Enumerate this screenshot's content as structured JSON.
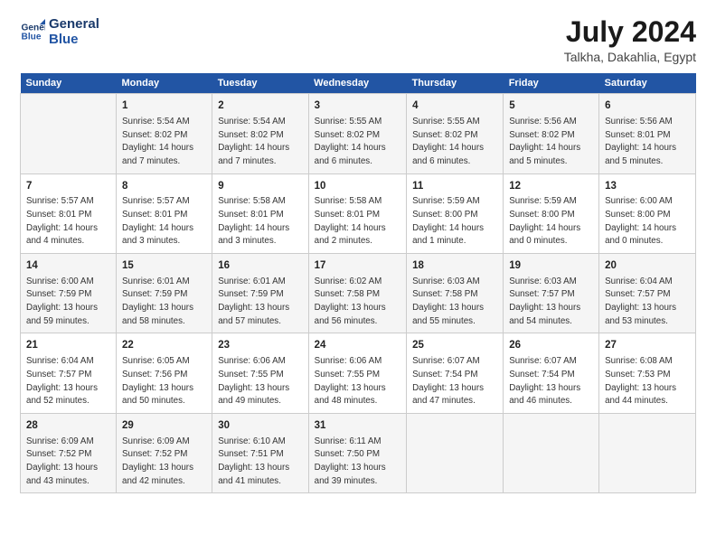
{
  "header": {
    "logo_line1": "General",
    "logo_line2": "Blue",
    "title": "July 2024",
    "subtitle": "Talkha, Dakahlia, Egypt"
  },
  "columns": [
    "Sunday",
    "Monday",
    "Tuesday",
    "Wednesday",
    "Thursday",
    "Friday",
    "Saturday"
  ],
  "weeks": [
    [
      {
        "day": "",
        "info": ""
      },
      {
        "day": "1",
        "info": "Sunrise: 5:54 AM\nSunset: 8:02 PM\nDaylight: 14 hours\nand 7 minutes."
      },
      {
        "day": "2",
        "info": "Sunrise: 5:54 AM\nSunset: 8:02 PM\nDaylight: 14 hours\nand 7 minutes."
      },
      {
        "day": "3",
        "info": "Sunrise: 5:55 AM\nSunset: 8:02 PM\nDaylight: 14 hours\nand 6 minutes."
      },
      {
        "day": "4",
        "info": "Sunrise: 5:55 AM\nSunset: 8:02 PM\nDaylight: 14 hours\nand 6 minutes."
      },
      {
        "day": "5",
        "info": "Sunrise: 5:56 AM\nSunset: 8:02 PM\nDaylight: 14 hours\nand 5 minutes."
      },
      {
        "day": "6",
        "info": "Sunrise: 5:56 AM\nSunset: 8:01 PM\nDaylight: 14 hours\nand 5 minutes."
      }
    ],
    [
      {
        "day": "7",
        "info": "Sunrise: 5:57 AM\nSunset: 8:01 PM\nDaylight: 14 hours\nand 4 minutes."
      },
      {
        "day": "8",
        "info": "Sunrise: 5:57 AM\nSunset: 8:01 PM\nDaylight: 14 hours\nand 3 minutes."
      },
      {
        "day": "9",
        "info": "Sunrise: 5:58 AM\nSunset: 8:01 PM\nDaylight: 14 hours\nand 3 minutes."
      },
      {
        "day": "10",
        "info": "Sunrise: 5:58 AM\nSunset: 8:01 PM\nDaylight: 14 hours\nand 2 minutes."
      },
      {
        "day": "11",
        "info": "Sunrise: 5:59 AM\nSunset: 8:00 PM\nDaylight: 14 hours\nand 1 minute."
      },
      {
        "day": "12",
        "info": "Sunrise: 5:59 AM\nSunset: 8:00 PM\nDaylight: 14 hours\nand 0 minutes."
      },
      {
        "day": "13",
        "info": "Sunrise: 6:00 AM\nSunset: 8:00 PM\nDaylight: 14 hours\nand 0 minutes."
      }
    ],
    [
      {
        "day": "14",
        "info": "Sunrise: 6:00 AM\nSunset: 7:59 PM\nDaylight: 13 hours\nand 59 minutes."
      },
      {
        "day": "15",
        "info": "Sunrise: 6:01 AM\nSunset: 7:59 PM\nDaylight: 13 hours\nand 58 minutes."
      },
      {
        "day": "16",
        "info": "Sunrise: 6:01 AM\nSunset: 7:59 PM\nDaylight: 13 hours\nand 57 minutes."
      },
      {
        "day": "17",
        "info": "Sunrise: 6:02 AM\nSunset: 7:58 PM\nDaylight: 13 hours\nand 56 minutes."
      },
      {
        "day": "18",
        "info": "Sunrise: 6:03 AM\nSunset: 7:58 PM\nDaylight: 13 hours\nand 55 minutes."
      },
      {
        "day": "19",
        "info": "Sunrise: 6:03 AM\nSunset: 7:57 PM\nDaylight: 13 hours\nand 54 minutes."
      },
      {
        "day": "20",
        "info": "Sunrise: 6:04 AM\nSunset: 7:57 PM\nDaylight: 13 hours\nand 53 minutes."
      }
    ],
    [
      {
        "day": "21",
        "info": "Sunrise: 6:04 AM\nSunset: 7:57 PM\nDaylight: 13 hours\nand 52 minutes."
      },
      {
        "day": "22",
        "info": "Sunrise: 6:05 AM\nSunset: 7:56 PM\nDaylight: 13 hours\nand 50 minutes."
      },
      {
        "day": "23",
        "info": "Sunrise: 6:06 AM\nSunset: 7:55 PM\nDaylight: 13 hours\nand 49 minutes."
      },
      {
        "day": "24",
        "info": "Sunrise: 6:06 AM\nSunset: 7:55 PM\nDaylight: 13 hours\nand 48 minutes."
      },
      {
        "day": "25",
        "info": "Sunrise: 6:07 AM\nSunset: 7:54 PM\nDaylight: 13 hours\nand 47 minutes."
      },
      {
        "day": "26",
        "info": "Sunrise: 6:07 AM\nSunset: 7:54 PM\nDaylight: 13 hours\nand 46 minutes."
      },
      {
        "day": "27",
        "info": "Sunrise: 6:08 AM\nSunset: 7:53 PM\nDaylight: 13 hours\nand 44 minutes."
      }
    ],
    [
      {
        "day": "28",
        "info": "Sunrise: 6:09 AM\nSunset: 7:52 PM\nDaylight: 13 hours\nand 43 minutes."
      },
      {
        "day": "29",
        "info": "Sunrise: 6:09 AM\nSunset: 7:52 PM\nDaylight: 13 hours\nand 42 minutes."
      },
      {
        "day": "30",
        "info": "Sunrise: 6:10 AM\nSunset: 7:51 PM\nDaylight: 13 hours\nand 41 minutes."
      },
      {
        "day": "31",
        "info": "Sunrise: 6:11 AM\nSunset: 7:50 PM\nDaylight: 13 hours\nand 39 minutes."
      },
      {
        "day": "",
        "info": ""
      },
      {
        "day": "",
        "info": ""
      },
      {
        "day": "",
        "info": ""
      }
    ]
  ]
}
